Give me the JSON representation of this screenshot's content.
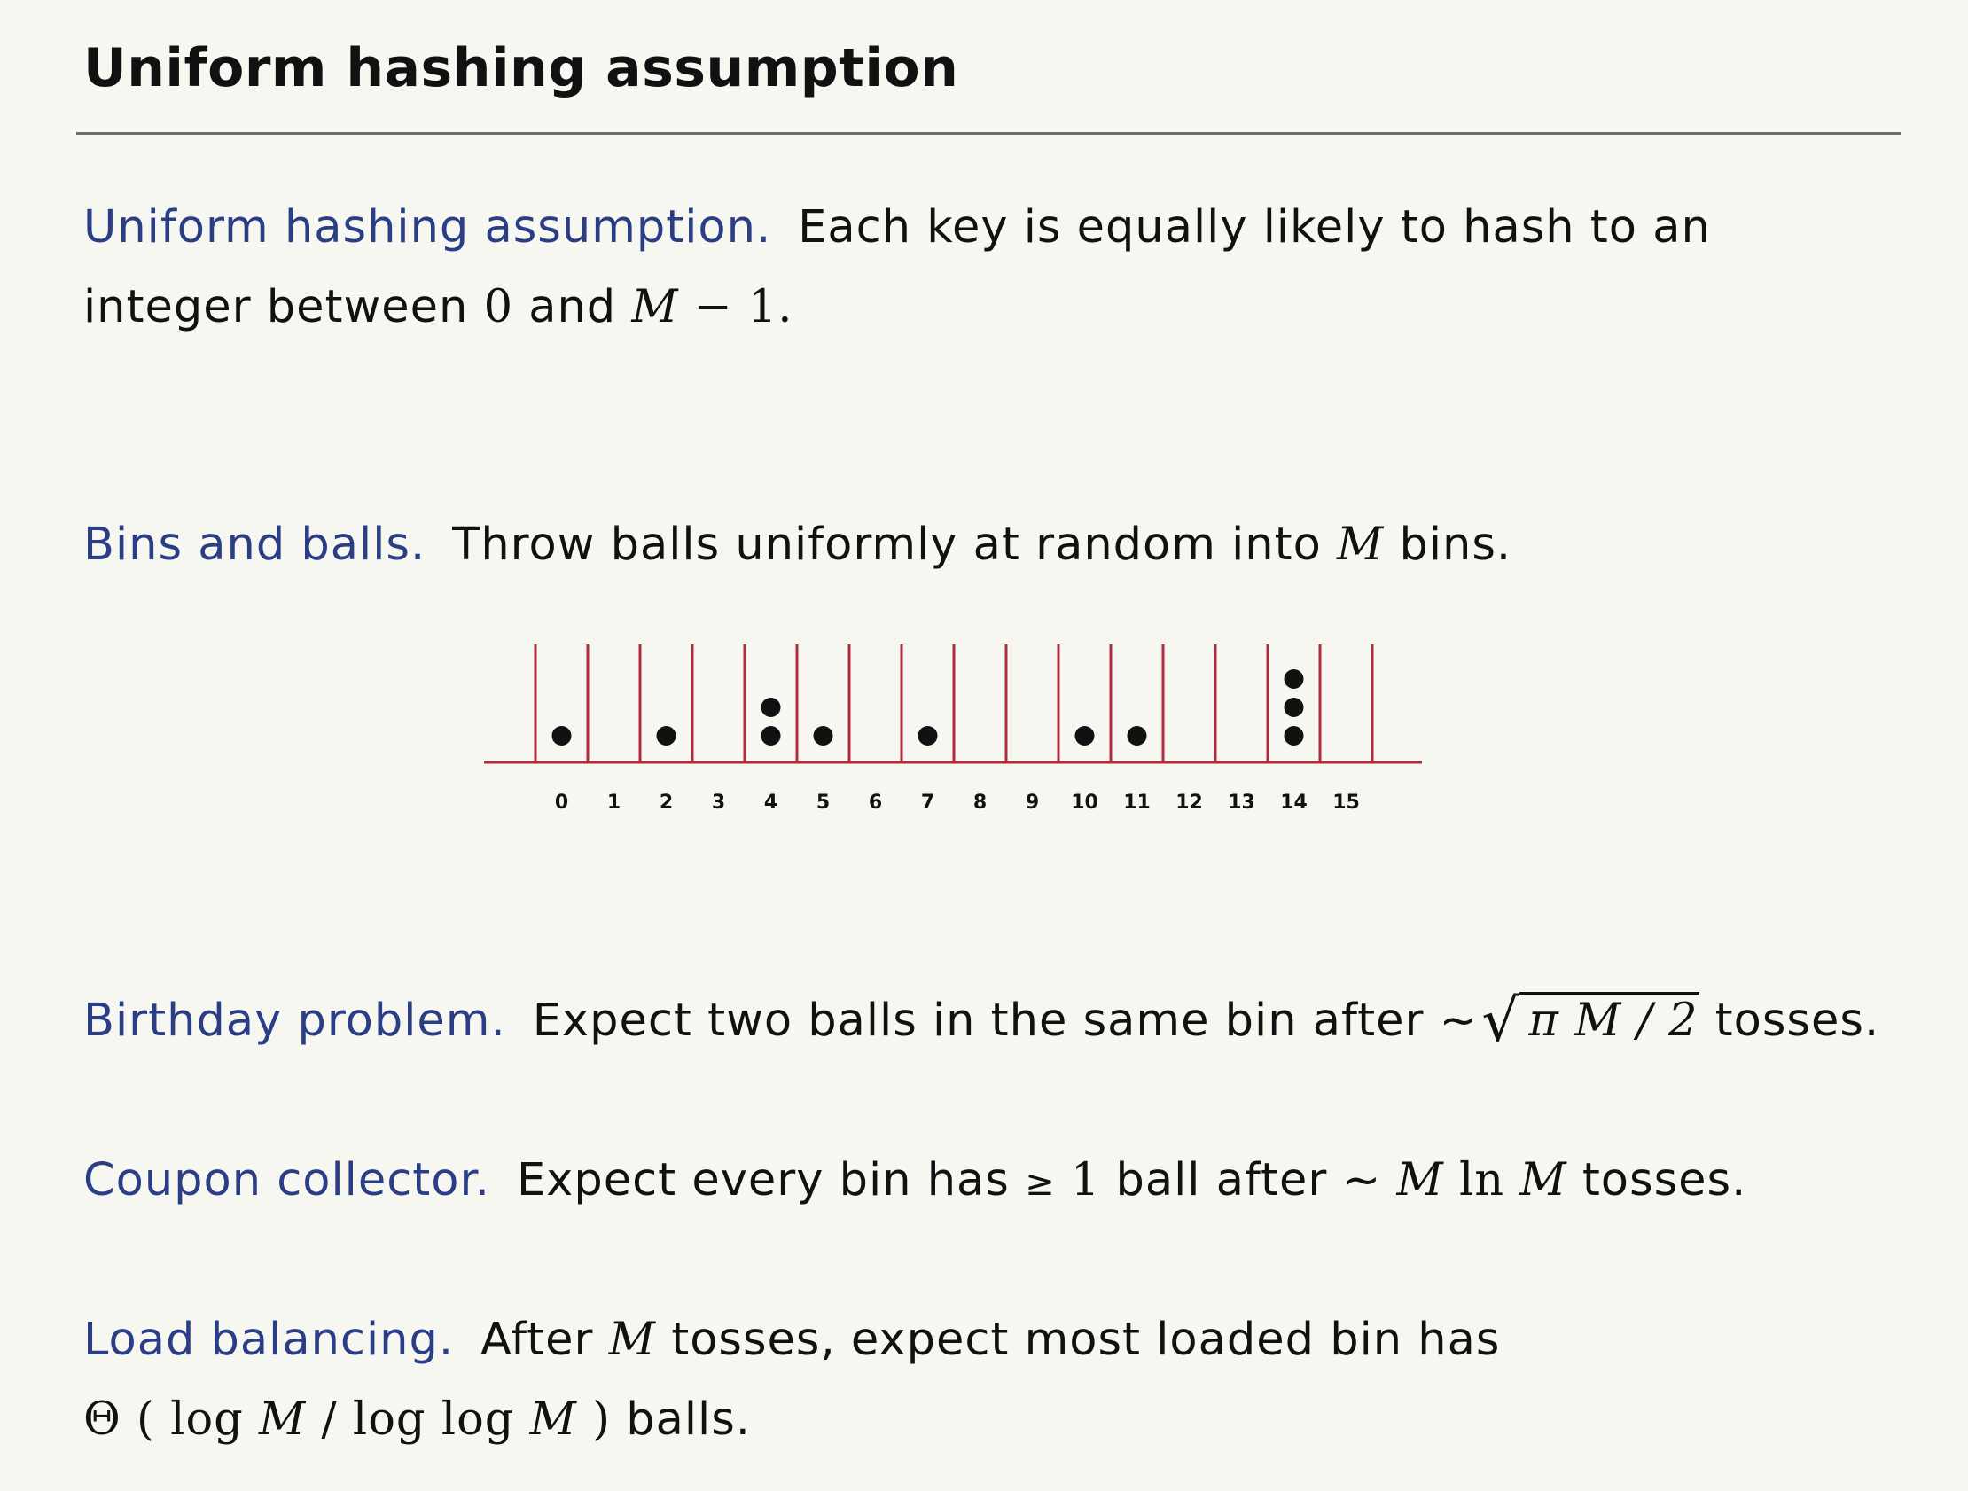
{
  "slide": {
    "title": "Uniform hashing assumption"
  },
  "uniform": {
    "term": "Uniform hashing assumption.",
    "text1": "Each key is equally likely to hash to an",
    "text2_a": "integer between",
    "zero": "0",
    "and": "and",
    "m": "M",
    "minus_one": "− 1."
  },
  "bins": {
    "term": "Bins and balls.",
    "text_a": "Throw balls uniformly at random into",
    "m": "M",
    "text_b": "bins."
  },
  "chart_data": {
    "type": "bar",
    "categories": [
      "0",
      "1",
      "2",
      "3",
      "4",
      "5",
      "6",
      "7",
      "8",
      "9",
      "10",
      "11",
      "12",
      "13",
      "14",
      "15"
    ],
    "values": [
      1,
      0,
      1,
      0,
      2,
      1,
      0,
      1,
      0,
      0,
      1,
      1,
      0,
      0,
      3,
      0
    ],
    "title": "",
    "xlabel": "",
    "ylabel": "",
    "grid": false,
    "colors": {
      "bin_wall": "#b22b3b",
      "ball": "#111111"
    }
  },
  "birthday": {
    "term": "Birthday problem.",
    "text_a": "Expect two balls in the same bin after ~",
    "radicand": "π M / 2",
    "text_b": "tosses."
  },
  "coupon": {
    "term": "Coupon collector.",
    "text_a": "Expect every bin has",
    "geq": "≥",
    "one": "1",
    "text_b": "ball after ~",
    "m1": "M",
    "ln": "ln",
    "m2": "M",
    "text_c": "tosses."
  },
  "load": {
    "term": "Load balancing.",
    "text_a": "After",
    "m": "M",
    "text_b": "tosses, expect most loaded bin has",
    "theta": "Θ",
    "expr_open": "(",
    "log1": "log",
    "m1": "M",
    "slash": "/",
    "log2": "log log",
    "m2": "M",
    "expr_close": ")",
    "text_c": "balls."
  },
  "colors": {
    "term": "#2a3d85",
    "background": "#f7f7f2"
  }
}
